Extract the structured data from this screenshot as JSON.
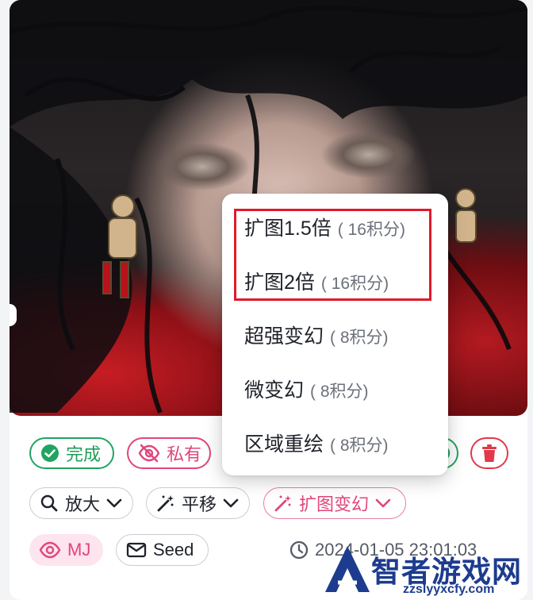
{
  "status": {
    "done_label": "完成",
    "private_label": "私有"
  },
  "actions": {
    "zoom_label": "放大",
    "pan_label": "平移",
    "expand_label": "扩图变幻"
  },
  "meta": {
    "model_label": "MJ",
    "seed_label": "Seed",
    "timestamp": "2024-01-05 23:01:03"
  },
  "menu": {
    "items": [
      {
        "label": "扩图1.5倍",
        "cost": "( 16积分)"
      },
      {
        "label": "扩图2倍",
        "cost": "( 16积分)"
      },
      {
        "label": "超强变幻",
        "cost": "( 8积分)"
      },
      {
        "label": "微变幻",
        "cost": "( 8积分)"
      },
      {
        "label": "区域重绘",
        "cost": "( 8积分)"
      }
    ]
  },
  "watermark": {
    "title": "智者游戏网",
    "url": "zzslyyxcfy.com"
  },
  "colors": {
    "green": "#22a361",
    "pink": "#e0457b",
    "red_delete": "#e0394a",
    "highlight": "#e01a2a",
    "watermark": "#1d3c8f"
  },
  "icons": {
    "done": "check-circle-icon",
    "private": "eye-slash-icon",
    "delete": "trash-icon",
    "zoom": "search-icon",
    "pan": "magic-wand-icon",
    "expand": "magic-wand-icon",
    "model": "eye-icon",
    "seed": "envelope-icon",
    "time": "clock-icon"
  }
}
